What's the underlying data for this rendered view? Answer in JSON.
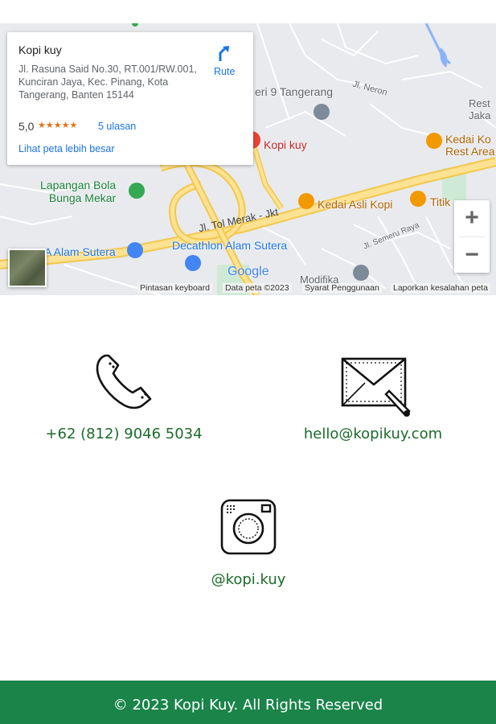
{
  "map": {
    "place_name": "Kopi kuy",
    "address": "Jl. Rasuna Said No.30, RT.001/RW.001, Kunciran Jaya, Kec. Pinang, Kota Tangerang, Banten 15144",
    "rating": "5,0",
    "stars": "★★★★★",
    "reviews": "5 ulasan",
    "bigger_map_link": "Lihat peta lebih besar",
    "route_label": "Rute",
    "labels": {
      "lapangan_bola": "Lapangan Bola\nBunga Mekar",
      "decathlon": "Decathlon Alam Sutera",
      "alam_sutera": "A Alam Sutera",
      "kedai_asli": "Kedai Asli Kopi",
      "titik": "Titik",
      "kedai_ko": "Kedai Ko\nRest Area",
      "rest_jaka": "Rest\nJaka",
      "kopi_kuy_pin": "Kopi kuy",
      "smp": "eri 9 Tangerang",
      "neron": "Jl. Neron",
      "tol": "Jl. Tol Merak - Jkt",
      "semeru": "Jl. Semeru Raya",
      "modifika": "Modifika",
      "google": "Google"
    },
    "zoom_in": "+",
    "zoom_out": "−",
    "footer": {
      "shortcuts": "Pintasan keyboard",
      "map_data": "Data peta ©2023",
      "terms": "Syarat Penggunaan",
      "report": "Laporkan kesalahan peta"
    }
  },
  "contacts": {
    "phone": "+62 (812) 9046 5034",
    "email": "hello@kopikuy.com",
    "instagram": "@kopi.kuy"
  },
  "footer": {
    "copyright": "© 2023 Kopi Kuy. All Rights Reserved"
  },
  "colors": {
    "accent_green": "#1a8449",
    "contact_text": "#1b6b2a",
    "link_blue": "#1a73e8"
  }
}
